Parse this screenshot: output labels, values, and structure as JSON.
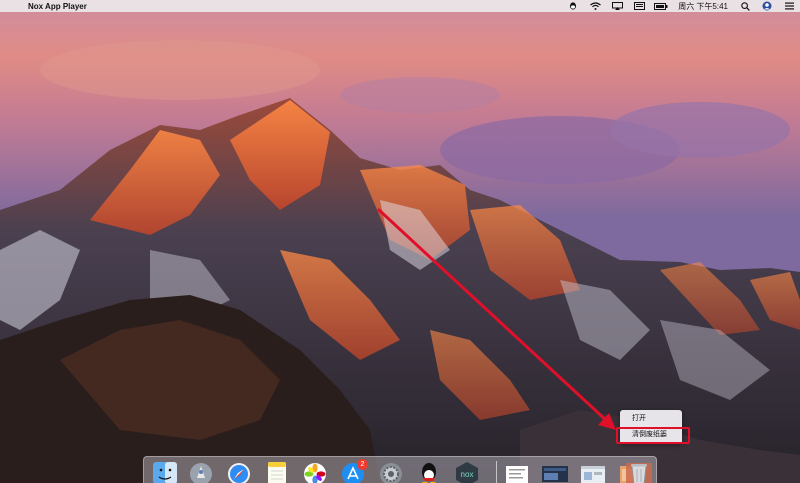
{
  "menubar": {
    "apple_glyph": "",
    "app_name": "Nox App Player",
    "clock": "周六 下午5:41",
    "status_icons": [
      "qq-icon",
      "wifi-icon",
      "airplay-icon",
      "keyboard-icon",
      "battery-icon",
      "clock-text",
      "search-icon",
      "user-icon",
      "menu-list-icon"
    ]
  },
  "context_menu": {
    "open_label": "打开",
    "empty_trash_label": "清倒废纸篓"
  },
  "dock": {
    "items": [
      "finder-icon",
      "launchpad-icon",
      "safari-icon",
      "notes-icon",
      "photos-icon",
      "app-store-icon",
      "system-preferences-icon",
      "qq-app-icon",
      "nox-icon",
      "document-thumbnail",
      "screen-thumbnail",
      "window-thumbnail",
      "folder-thumbnail",
      "trash-icon"
    ],
    "app_store_badge": "2"
  },
  "colors": {
    "highlight": "#e0102a",
    "arrow": "#e0102a",
    "badge": "#ee3b30"
  }
}
